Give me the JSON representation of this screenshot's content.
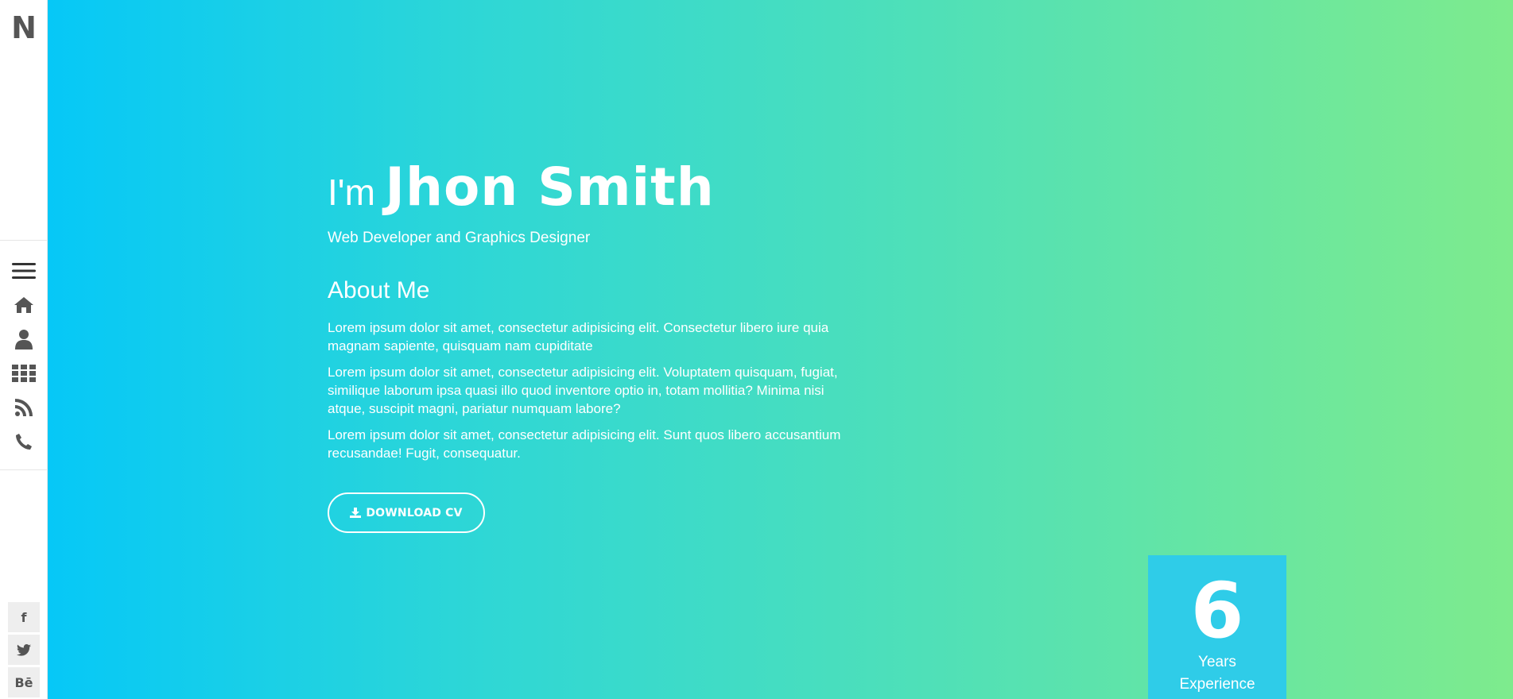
{
  "sidebar": {
    "logo": "N",
    "nav": [
      {
        "icon": "menu-icon"
      },
      {
        "icon": "home-icon"
      },
      {
        "icon": "user-icon"
      },
      {
        "icon": "grid-icon"
      },
      {
        "icon": "rss-icon"
      },
      {
        "icon": "phone-icon"
      }
    ],
    "social": [
      {
        "icon": "facebook-icon",
        "glyph": "f"
      },
      {
        "icon": "twitter-icon",
        "glyph": ""
      },
      {
        "icon": "behance-icon",
        "glyph": "Bē"
      }
    ]
  },
  "hero": {
    "greeting_prefix": "I'm",
    "name": "Jhon Smith",
    "role": "Web Developer and Graphics Designer",
    "about_title": "About Me",
    "paragraphs": [
      "Lorem ipsum dolor sit amet, consectetur adipisicing elit. Consectetur libero iure quia magnam sapiente, quisquam nam cupiditate",
      "Lorem ipsum dolor sit amet, consectetur adipisicing elit. Voluptatem quisquam, fugiat, similique laborum ipsa quasi illo quod inventore optio in, totam mollitia? Minima nisi atque, suscipit magni, pariatur numquam labore?",
      "Lorem ipsum dolor sit amet, consectetur adipisicing elit. Sunt quos libero accusantium recusandae! Fugit, consequatur."
    ],
    "download_label": "DOWNLOAD CV"
  },
  "experience": {
    "number": "6",
    "label_line1": "Years",
    "label_line2": "Experience"
  },
  "colors": {
    "gradient_start": "#06c8f7",
    "gradient_end": "#7eeb8d",
    "experience_box": "#2fcce8",
    "icon": "#555555"
  }
}
